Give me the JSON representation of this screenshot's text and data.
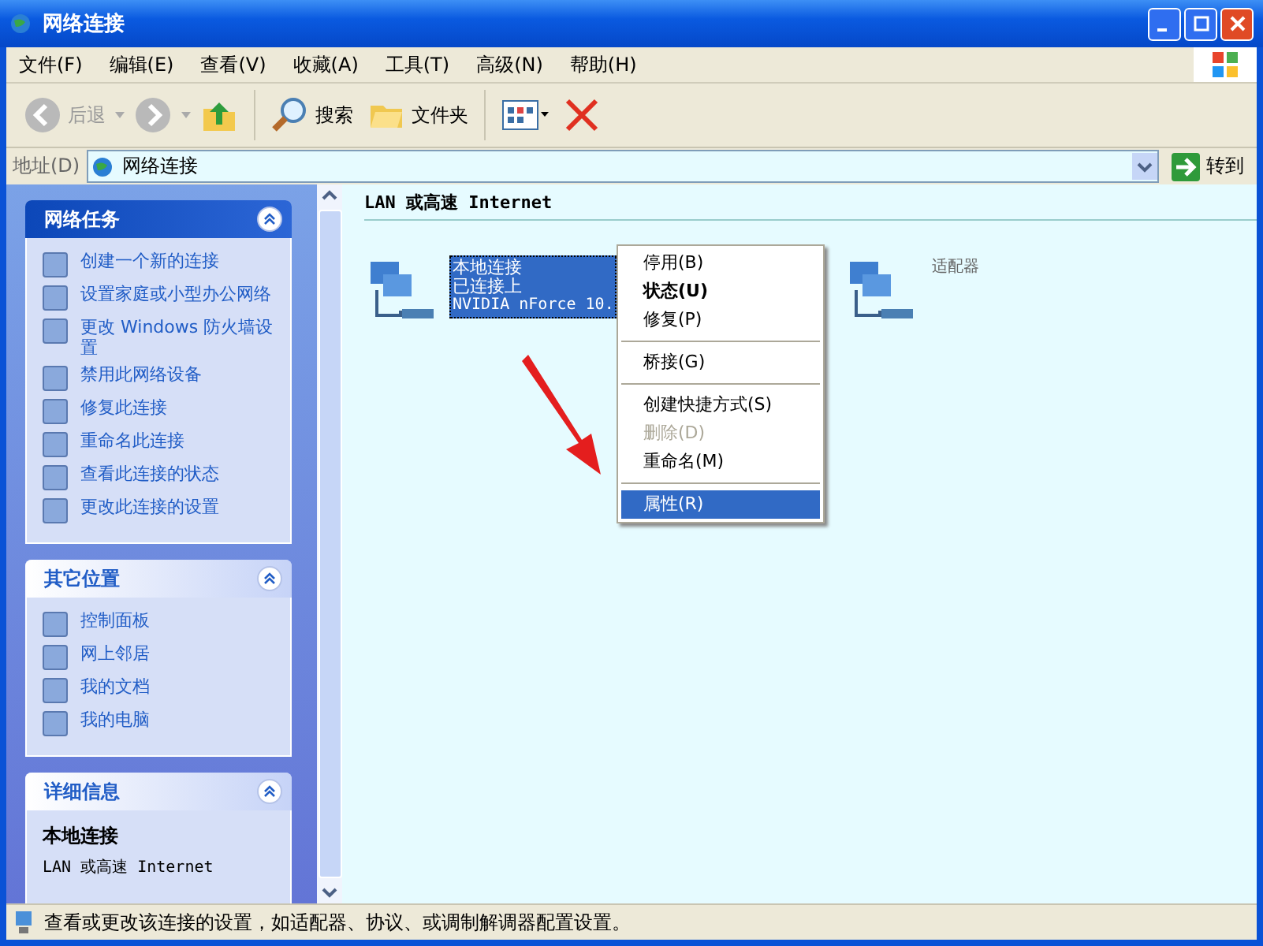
{
  "window": {
    "title": "网络连接"
  },
  "menu_bar": [
    "文件(F)",
    "编辑(E)",
    "查看(V)",
    "收藏(A)",
    "工具(T)",
    "高级(N)",
    "帮助(H)"
  ],
  "toolbar": {
    "back": "后退",
    "search": "搜索",
    "folders": "文件夹"
  },
  "address_bar": {
    "label": "地址(D)",
    "value": "网络连接",
    "go": "转到"
  },
  "sidebar": [
    {
      "title": "网络任务",
      "expanded": true,
      "items": [
        "创建一个新的连接",
        "设置家庭或小型办公网络",
        "更改 Windows 防火墙设置",
        "禁用此网络设备",
        "修复此连接",
        "重命名此连接",
        "查看此连接的状态",
        "更改此连接的设置"
      ]
    },
    {
      "title": "其它位置",
      "expanded": true,
      "items": [
        "控制面板",
        "网上邻居",
        "我的文档",
        "我的电脑"
      ]
    },
    {
      "title": "详细信息",
      "expanded": true,
      "name": "本地连接",
      "description": "LAN 或高速 Internet"
    }
  ],
  "content": {
    "group_heading": "LAN 或高速 Internet",
    "connections": [
      {
        "name": "本地连接",
        "status": "已连接上",
        "device": "NVIDIA nForce 10.",
        "selected": true
      },
      {
        "device": "适配器",
        "selected": false
      }
    ]
  },
  "context_menu": [
    {
      "kind": "item",
      "label": "停用(B)",
      "bold": false,
      "disabled": false,
      "selected": false
    },
    {
      "kind": "item",
      "label": "状态(U)",
      "bold": true,
      "disabled": false,
      "selected": false
    },
    {
      "kind": "item",
      "label": "修复(P)",
      "bold": false,
      "disabled": false,
      "selected": false
    },
    {
      "kind": "separator"
    },
    {
      "kind": "item",
      "label": "桥接(G)",
      "bold": false,
      "disabled": false,
      "selected": false
    },
    {
      "kind": "separator"
    },
    {
      "kind": "item",
      "label": "创建快捷方式(S)",
      "bold": false,
      "disabled": false,
      "selected": false
    },
    {
      "kind": "item",
      "label": "删除(D)",
      "bold": false,
      "disabled": true,
      "selected": false
    },
    {
      "kind": "item",
      "label": "重命名(M)",
      "bold": false,
      "disabled": false,
      "selected": false
    },
    {
      "kind": "separator"
    },
    {
      "kind": "item",
      "label": "属性(R)",
      "bold": false,
      "disabled": false,
      "selected": true
    }
  ],
  "status_bar": "查看或更改该连接的设置，如适配器、协议、或调制解调器配置设置。"
}
